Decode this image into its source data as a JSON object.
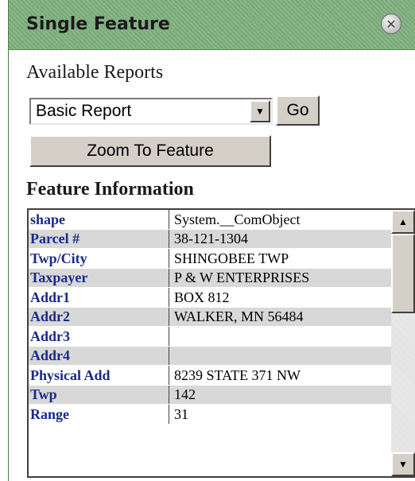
{
  "panel": {
    "title": "Single Feature",
    "close_icon": "close-icon"
  },
  "reports": {
    "label": "Available Reports",
    "selected": "Basic Report",
    "go_label": "Go",
    "zoom_label": "Zoom To Feature"
  },
  "feature_info": {
    "heading": "Feature Information",
    "rows": [
      {
        "key": "shape",
        "value": "System.__ComObject"
      },
      {
        "key": "Parcel #",
        "value": "38-121-1304"
      },
      {
        "key": "Twp/City",
        "value": "SHINGOBEE TWP"
      },
      {
        "key": "Taxpayer",
        "value": "P & W ENTERPRISES"
      },
      {
        "key": "Addr1",
        "value": "BOX 812"
      },
      {
        "key": "Addr2",
        "value": "WALKER, MN 56484"
      },
      {
        "key": "Addr3",
        "value": ""
      },
      {
        "key": "Addr4",
        "value": ""
      },
      {
        "key": "Physical Add",
        "value": "8239 STATE 371 NW"
      },
      {
        "key": "Twp",
        "value": "142"
      },
      {
        "key": "Range",
        "value": "31"
      }
    ]
  },
  "colors": {
    "title_bar": "#7fb07f",
    "key_text": "#1a2a8a",
    "alt_row": "#d8d8d8"
  }
}
